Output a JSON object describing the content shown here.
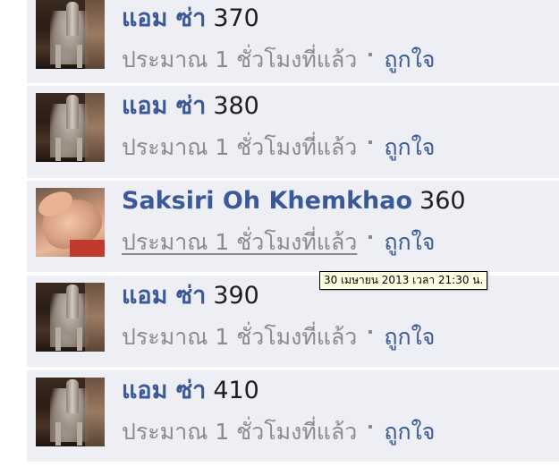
{
  "comments": [
    {
      "author": "แอม ซ่า",
      "text": "370",
      "timestamp": "ประมาณ 1 ชั่วโมงที่แล้ว",
      "like_label": "ถูกใจ",
      "avatar_icon": "horse-statue-avatar"
    },
    {
      "author": "แอม ซ่า",
      "text": "380",
      "timestamp": "ประมาณ 1 ชั่วโมงที่แล้ว",
      "like_label": "ถูกใจ",
      "avatar_icon": "horse-statue-avatar"
    },
    {
      "author": "Saksiri Oh Khemkhao",
      "text": "360",
      "timestamp": "ประมาณ 1 ชั่วโมงที่แล้ว",
      "like_label": "ถูกใจ",
      "avatar_icon": "person-photo-avatar"
    },
    {
      "author": "แอม ซ่า",
      "text": "390",
      "timestamp": "ประมาณ 1 ชั่วโมงที่แล้ว",
      "like_label": "ถูกใจ",
      "avatar_icon": "horse-statue-avatar"
    },
    {
      "author": "แอม ซ่า",
      "text": "410",
      "timestamp": "ประมาณ 1 ชั่วโมงที่แล้ว",
      "like_label": "ถูกใจ",
      "avatar_icon": "horse-statue-avatar"
    }
  ],
  "tooltip": {
    "text": "30 เมษายน 2013 เวลา 21:30 น."
  },
  "colors": {
    "link": "#3b5998",
    "meta": "#8b8b8b",
    "row_background": "#edeff4",
    "tooltip_background": "#ffffe1"
  }
}
